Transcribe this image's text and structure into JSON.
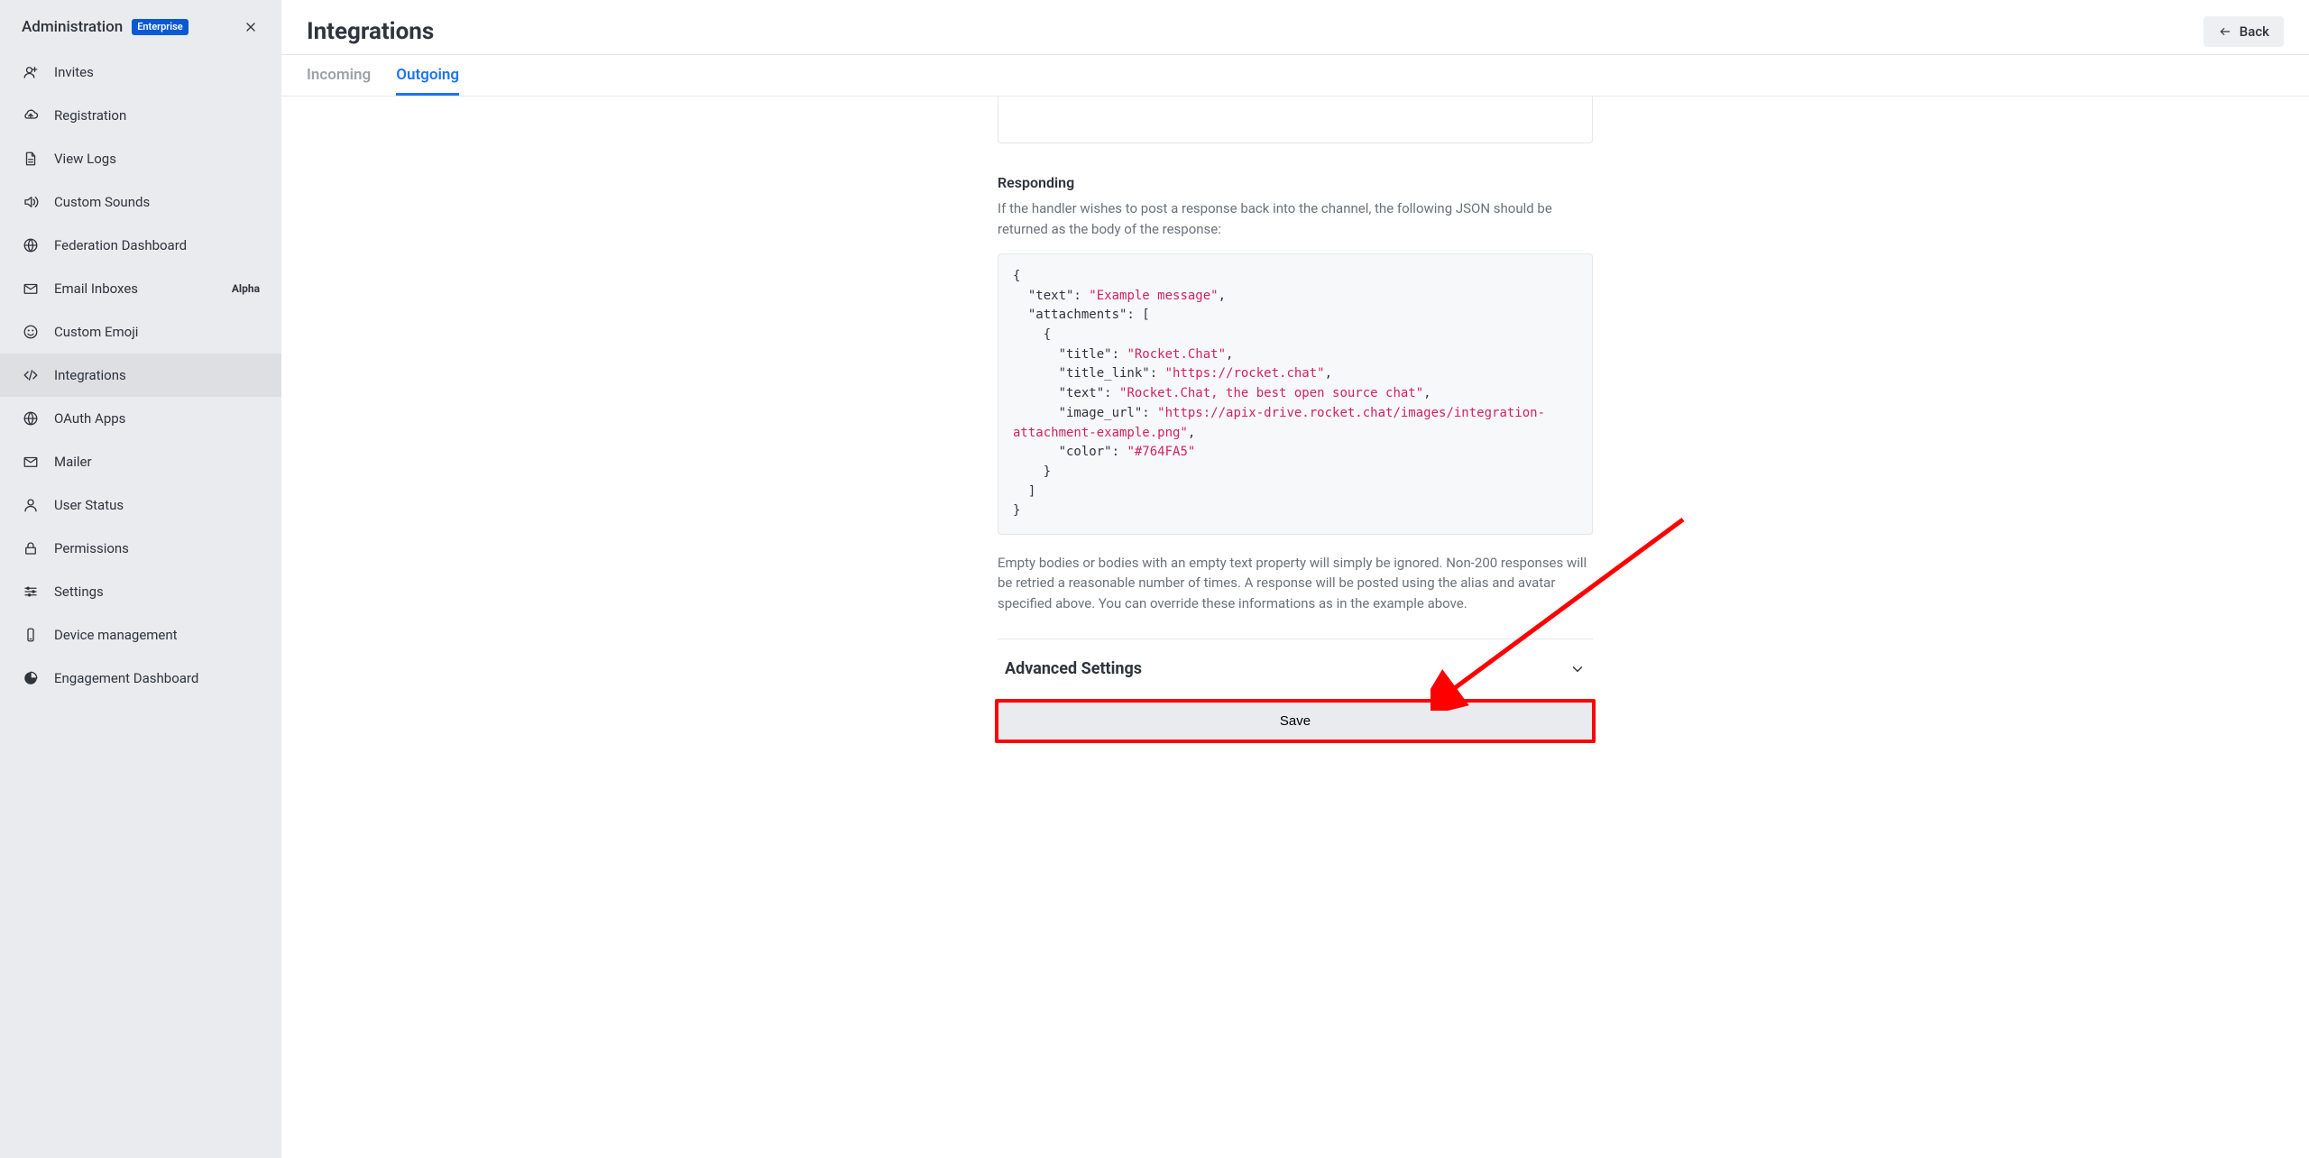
{
  "sidebar": {
    "title": "Administration",
    "badge": "Enterprise",
    "items": [
      {
        "key": "invites",
        "label": "Invites",
        "icon": "user-plus"
      },
      {
        "key": "registration",
        "label": "Registration",
        "icon": "cloud"
      },
      {
        "key": "view-logs",
        "label": "View Logs",
        "icon": "file"
      },
      {
        "key": "custom-sounds",
        "label": "Custom Sounds",
        "icon": "volume"
      },
      {
        "key": "federation-dashboard",
        "label": "Federation Dashboard",
        "icon": "globe"
      },
      {
        "key": "email-inboxes",
        "label": "Email Inboxes",
        "icon": "mail",
        "tag": "Alpha"
      },
      {
        "key": "custom-emoji",
        "label": "Custom Emoji",
        "icon": "emoji"
      },
      {
        "key": "integrations",
        "label": "Integrations",
        "icon": "code",
        "active": true
      },
      {
        "key": "oauth-apps",
        "label": "OAuth Apps",
        "icon": "globe"
      },
      {
        "key": "mailer",
        "label": "Mailer",
        "icon": "mail"
      },
      {
        "key": "user-status",
        "label": "User Status",
        "icon": "user"
      },
      {
        "key": "permissions",
        "label": "Permissions",
        "icon": "lock"
      },
      {
        "key": "settings",
        "label": "Settings",
        "icon": "sliders"
      },
      {
        "key": "device-management",
        "label": "Device management",
        "icon": "device"
      },
      {
        "key": "engagement-dashboard",
        "label": "Engagement Dashboard",
        "icon": "pie"
      }
    ]
  },
  "header": {
    "title": "Integrations",
    "back_label": "Back"
  },
  "tabs": {
    "incoming": "Incoming",
    "outgoing": "Outgoing",
    "active": "outgoing"
  },
  "responding": {
    "title": "Responding",
    "help": "If the handler wishes to post a response back into the channel, the following JSON should be returned as the body of the response:",
    "json": {
      "text": "Example message",
      "attachments": [
        {
          "title": "Rocket.Chat",
          "title_link": "https://rocket.chat",
          "text": "Rocket.Chat, the best open source chat",
          "image_url": "https://apix-drive.rocket.chat/images/integration-attachment-example.png",
          "color": "#764FA5"
        }
      ]
    },
    "footnote": "Empty bodies or bodies with an empty text property will simply be ignored. Non-200 responses will be retried a reasonable number of times. A response will be posted using the alias and avatar specified above. You can override these informations as in the example above."
  },
  "advanced": {
    "title": "Advanced Settings"
  },
  "save": {
    "label": "Save"
  }
}
